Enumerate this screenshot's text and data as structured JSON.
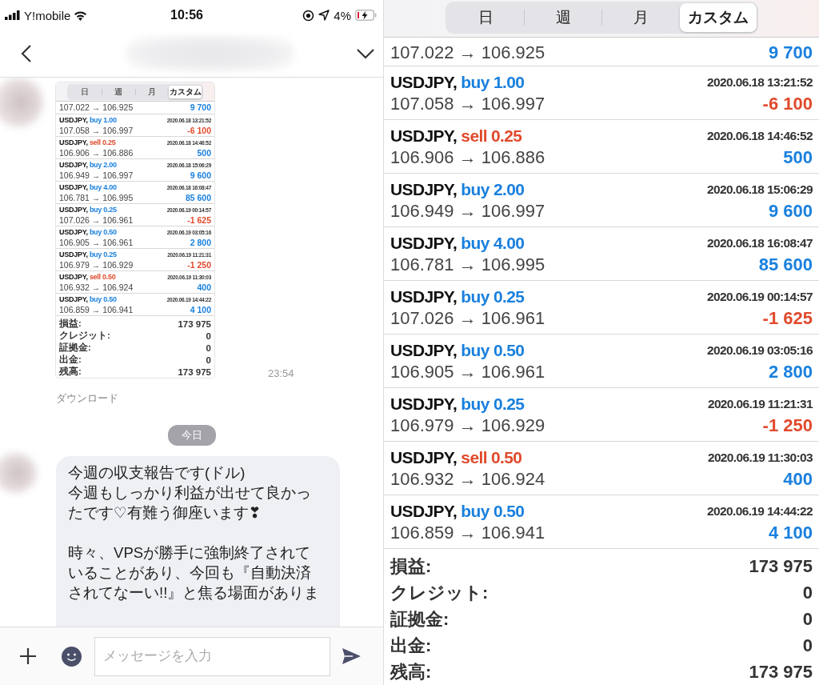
{
  "status_bar": {
    "carrier": "Y!mobile",
    "time": "10:56",
    "battery": "4%"
  },
  "chat": {
    "messages": [
      {
        "kind": "image",
        "report": {
          "tabs": [
            {
              "label": "日",
              "selected": false
            },
            {
              "label": "週",
              "selected": false
            },
            {
              "label": "月",
              "selected": false
            },
            {
              "label": "カスタム",
              "selected": true
            }
          ],
          "rows": [
            {
              "kind": "partial",
              "prices": "107.022 → 106.925",
              "profit": "9 700",
              "loss": false
            },
            {
              "kind": "trade",
              "symbol": "USDJPY,",
              "color": "#1a80de",
              "order": "buy 1.00",
              "time": "2020.06.18 13:21:52",
              "prices": "107.058 → 106.997",
              "profit": "-6 100",
              "loss": true
            },
            {
              "kind": "trade",
              "symbol": "USDJPY,",
              "color": "#e04a2c",
              "order": "sell 0.25",
              "time": "2020.06.18 14:46:52",
              "prices": "106.906 → 106.886",
              "profit": "500",
              "loss": false
            },
            {
              "kind": "trade",
              "symbol": "USDJPY,",
              "color": "#1a80de",
              "order": "buy 2.00",
              "time": "2020.06.18 15:06:29",
              "prices": "106.949 → 106.997",
              "profit": "9 600",
              "loss": false
            },
            {
              "kind": "trade",
              "symbol": "USDJPY,",
              "color": "#1a80de",
              "order": "buy 4.00",
              "time": "2020.06.18 16:08:47",
              "prices": "106.781 → 106.995",
              "profit": "85 600",
              "loss": false
            },
            {
              "kind": "trade",
              "symbol": "USDJPY,",
              "color": "#1a80de",
              "order": "buy 0.25",
              "time": "2020.06.19 00:14:57",
              "prices": "107.026 → 106.961",
              "profit": "-1 625",
              "loss": true
            },
            {
              "kind": "trade",
              "symbol": "USDJPY,",
              "color": "#1a80de",
              "order": "buy 0.50",
              "time": "2020.06.19 03:05:16",
              "prices": "106.905 → 106.961",
              "profit": "2 800",
              "loss": false
            },
            {
              "kind": "trade",
              "symbol": "USDJPY,",
              "color": "#1a80de",
              "order": "buy 0.25",
              "time": "2020.06.19 11:21:31",
              "prices": "106.979 → 106.929",
              "profit": "-1 250",
              "loss": true
            },
            {
              "kind": "trade",
              "symbol": "USDJPY,",
              "color": "#e04a2c",
              "order": "sell 0.50",
              "time": "2020.06.19 11:30:03",
              "prices": "106.932 → 106.924",
              "profit": "400",
              "loss": false
            },
            {
              "kind": "trade",
              "symbol": "USDJPY,",
              "color": "#1a80de",
              "order": "buy 0.50",
              "time": "2020.06.19 14:44:22",
              "prices": "106.859 → 106.941",
              "profit": "4 100",
              "loss": false
            }
          ],
          "summary": [
            {
              "label": "損益:",
              "value": "173 975"
            },
            {
              "label": "クレジット:",
              "value": "0"
            },
            {
              "label": "証拠金:",
              "value": "0"
            },
            {
              "label": "出金:",
              "value": "0"
            },
            {
              "label": "残高:",
              "value": "173 975"
            }
          ]
        },
        "time": "23:54",
        "action": "ダウンロード"
      },
      {
        "kind": "date",
        "label": "今日"
      },
      {
        "kind": "text",
        "paragraphs": [
          [
            "今週の収支報告です(ドル)",
            "今週もしっかり利益が出せて良かっ",
            "たです♡有難う御座います❣"
          ],
          [
            "時々、VPSが勝手に強制終了されて",
            "いることがあり、今回も『自動決済",
            "されてなーい!!』と焦る場面がありま"
          ]
        ]
      }
    ],
    "composer": {
      "placeholder": "メッセージを入力"
    }
  },
  "report": {
    "tabs": [
      {
        "label": "日",
        "selected": false
      },
      {
        "label": "週",
        "selected": false
      },
      {
        "label": "月",
        "selected": false
      },
      {
        "label": "カスタム",
        "selected": true
      }
    ],
    "rows": [
      {
        "kind": "partial",
        "prices": "107.022 → 106.925",
        "profit": "9 700",
        "loss": false
      },
      {
        "kind": "trade",
        "symbol": "USDJPY,",
        "color": "#1a80de",
        "order": "buy 1.00",
        "time": "2020.06.18 13:21:52",
        "prices": "107.058 → 106.997",
        "profit": "-6 100",
        "loss": true
      },
      {
        "kind": "trade",
        "symbol": "USDJPY,",
        "color": "#e04a2c",
        "order": "sell 0.25",
        "time": "2020.06.18 14:46:52",
        "prices": "106.906 → 106.886",
        "profit": "500",
        "loss": false
      },
      {
        "kind": "trade",
        "symbol": "USDJPY,",
        "color": "#1a80de",
        "order": "buy 2.00",
        "time": "2020.06.18 15:06:29",
        "prices": "106.949 → 106.997",
        "profit": "9 600",
        "loss": false
      },
      {
        "kind": "trade",
        "symbol": "USDJPY,",
        "color": "#1a80de",
        "order": "buy 4.00",
        "time": "2020.06.18 16:08:47",
        "prices": "106.781 → 106.995",
        "profit": "85 600",
        "loss": false
      },
      {
        "kind": "trade",
        "symbol": "USDJPY,",
        "color": "#1a80de",
        "order": "buy 0.25",
        "time": "2020.06.19 00:14:57",
        "prices": "107.026 → 106.961",
        "profit": "-1 625",
        "loss": true
      },
      {
        "kind": "trade",
        "symbol": "USDJPY,",
        "color": "#1a80de",
        "order": "buy 0.50",
        "time": "2020.06.19 03:05:16",
        "prices": "106.905 → 106.961",
        "profit": "2 800",
        "loss": false
      },
      {
        "kind": "trade",
        "symbol": "USDJPY,",
        "color": "#1a80de",
        "order": "buy 0.25",
        "time": "2020.06.19 11:21:31",
        "prices": "106.979 → 106.929",
        "profit": "-1 250",
        "loss": true
      },
      {
        "kind": "trade",
        "symbol": "USDJPY,",
        "color": "#e04a2c",
        "order": "sell 0.50",
        "time": "2020.06.19 11:30:03",
        "prices": "106.932 → 106.924",
        "profit": "400",
        "loss": false
      },
      {
        "kind": "trade",
        "symbol": "USDJPY,",
        "color": "#1a80de",
        "order": "buy 0.50",
        "time": "2020.06.19 14:44:22",
        "prices": "106.859 → 106.941",
        "profit": "4 100",
        "loss": false
      }
    ],
    "summary": [
      {
        "label": "損益:",
        "value": "173 975"
      },
      {
        "label": "クレジット:",
        "value": "0"
      },
      {
        "label": "証拠金:",
        "value": "0"
      },
      {
        "label": "出金:",
        "value": "0"
      },
      {
        "label": "残高:",
        "value": "173 975"
      }
    ]
  }
}
